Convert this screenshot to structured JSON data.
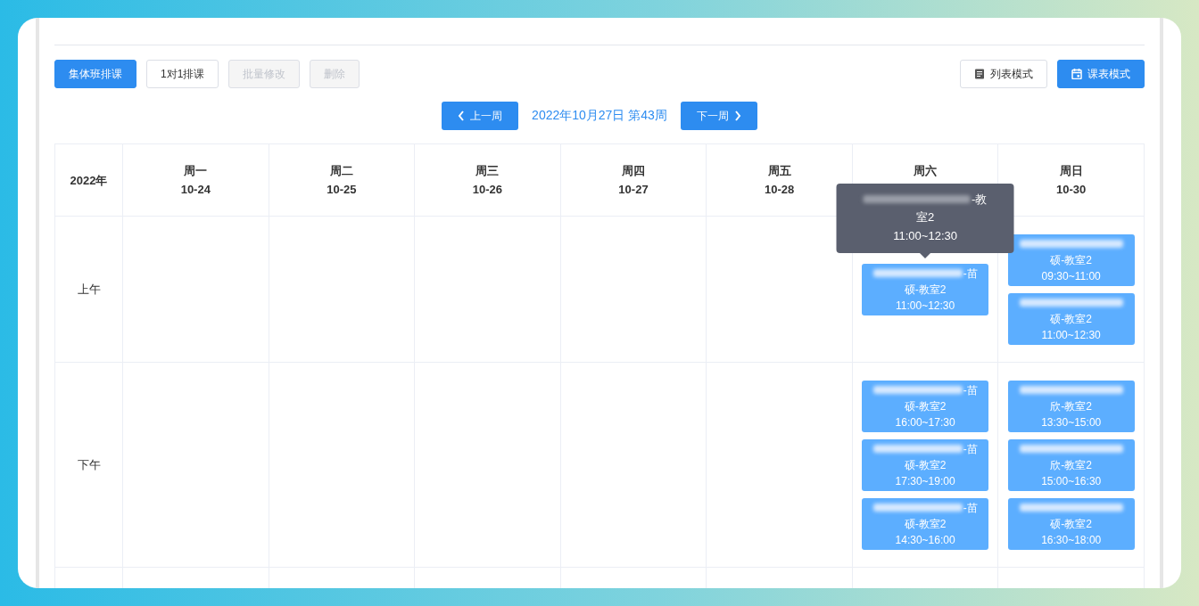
{
  "actions": [
    {
      "label": "集体班排课",
      "kind": "primary",
      "disabled": false
    },
    {
      "label": "1对1排课",
      "kind": "default",
      "disabled": false
    },
    {
      "label": "批量修改",
      "kind": "default",
      "disabled": true
    },
    {
      "label": "删除",
      "kind": "default",
      "disabled": true
    }
  ],
  "view_modes": [
    {
      "label": "列表模式",
      "kind": "list",
      "selected": false
    },
    {
      "label": "课表模式",
      "kind": "calendar",
      "selected": true
    }
  ],
  "week_nav": {
    "prev": "上一周",
    "current": "2022年10月27日 第43周",
    "next": "下一周"
  },
  "table": {
    "corner": "2022年",
    "columns": [
      {
        "day": "周一",
        "date": "10-24"
      },
      {
        "day": "周二",
        "date": "10-25"
      },
      {
        "day": "周三",
        "date": "10-26"
      },
      {
        "day": "周四",
        "date": "10-27"
      },
      {
        "day": "周五",
        "date": "10-28"
      },
      {
        "day": "周六"
      },
      {
        "day": "周日",
        "date": "10-30"
      }
    ],
    "rows": [
      {
        "label": "上午",
        "cells": [
          [],
          [],
          [],
          [],
          [],
          [
            {
              "line1_visible": "-苗",
              "line2": "硕-教室2",
              "time": "11:00~12:30",
              "tooltip": {
                "line1_visible": "-教",
                "line2": "室2",
                "time": "11:00~12:30"
              }
            }
          ],
          [
            {
              "line2": "硕-教室2",
              "time": "09:30~11:00"
            },
            {
              "line2": "硕-教室2",
              "time": "11:00~12:30"
            }
          ]
        ]
      },
      {
        "label": "下午",
        "cells": [
          [],
          [],
          [],
          [],
          [],
          [
            {
              "line1_visible": "-苗",
              "line2": "硕-教室2",
              "time": "16:00~17:30"
            },
            {
              "line1_visible": "-苗",
              "line2": "硕-教室2",
              "time": "17:30~19:00"
            },
            {
              "line1_visible": "-苗",
              "line2": "硕-教室2",
              "time": "14:30~16:00"
            }
          ],
          [
            {
              "line2": "欣-教室2",
              "time": "13:30~15:00"
            },
            {
              "line2": "欣-教室2",
              "time": "15:00~16:30"
            },
            {
              "line2": "硕-教室2",
              "time": "16:30~18:00"
            }
          ]
        ]
      }
    ]
  }
}
